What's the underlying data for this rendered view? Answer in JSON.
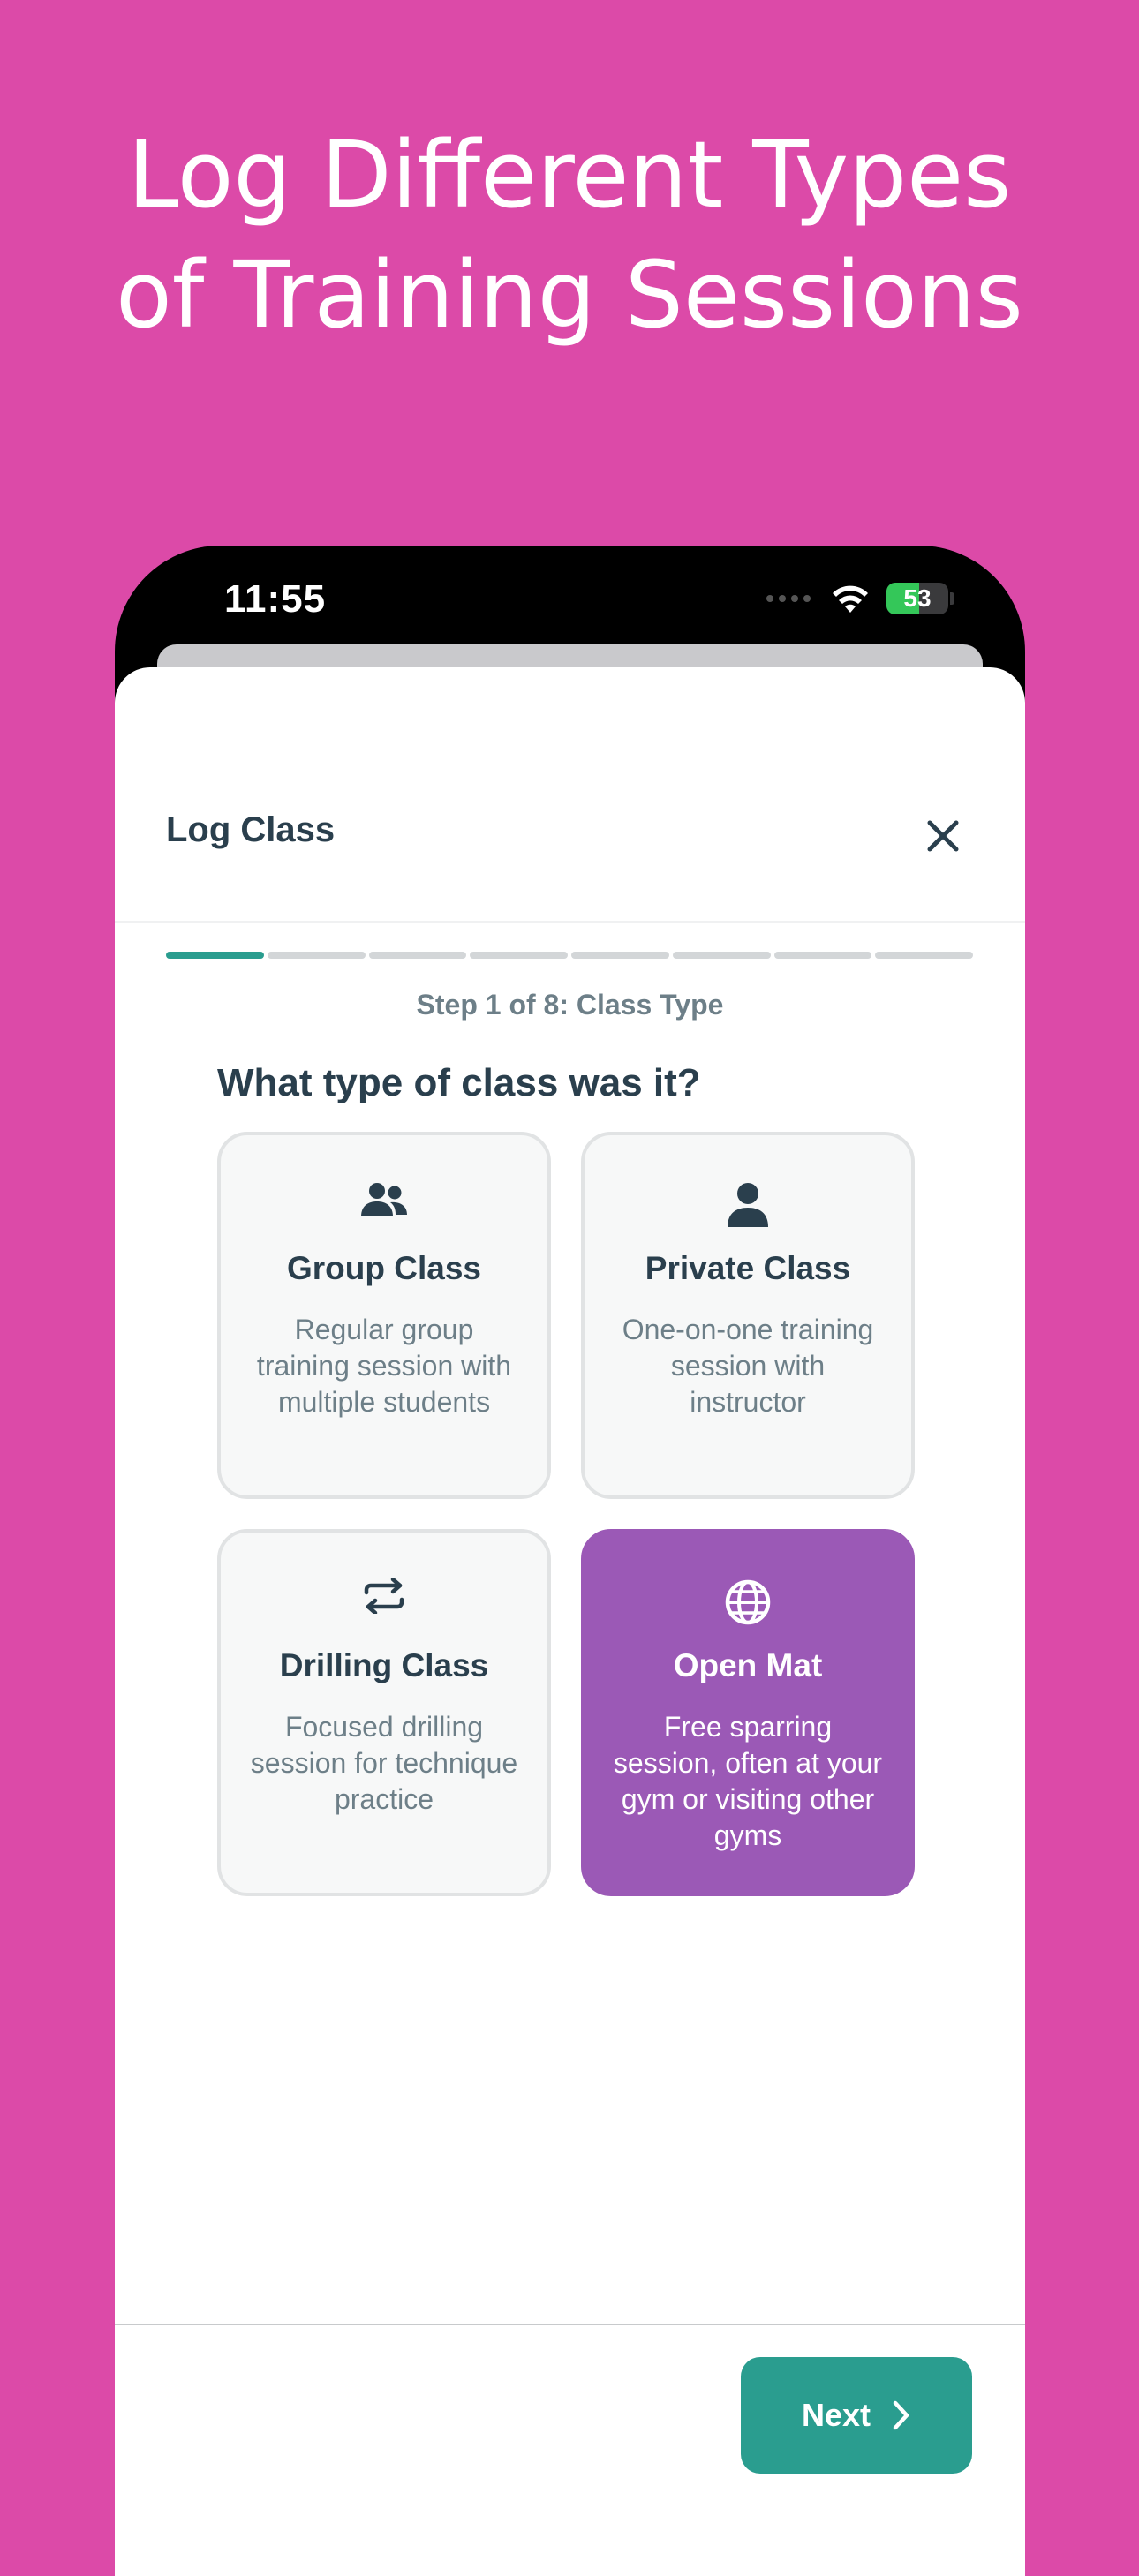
{
  "headline": {
    "line1": "Log Different Types",
    "line2": "of Training Sessions"
  },
  "status_bar": {
    "time": "11:55",
    "battery_percent": "53",
    "battery_level": 0.53
  },
  "modal": {
    "title": "Log Class",
    "step_label": "Step 1 of 8: Class Type",
    "current_step": 1,
    "total_steps": 8,
    "question": "What type of class was it?"
  },
  "options": [
    {
      "name": "Group Class",
      "description": "Regular group training session with multiple students",
      "icon": "group-icon",
      "selected": false
    },
    {
      "name": "Private Class",
      "description": "One-on-one training session with instructor",
      "icon": "person-icon",
      "selected": false
    },
    {
      "name": "Drilling Class",
      "description": "Focused drilling session for technique practice",
      "icon": "repeat-icon",
      "selected": false
    },
    {
      "name": "Open Mat",
      "description": "Free sparring session, often at your gym or visiting other gyms",
      "icon": "globe-icon",
      "selected": true
    }
  ],
  "footer": {
    "next_label": "Next"
  },
  "colors": {
    "background": "#dc4aa8",
    "accent": "#2a9d8f",
    "selected_card": "#9b59b6",
    "heading_text": "#2a3f4d",
    "muted_text": "#6d7f88"
  }
}
